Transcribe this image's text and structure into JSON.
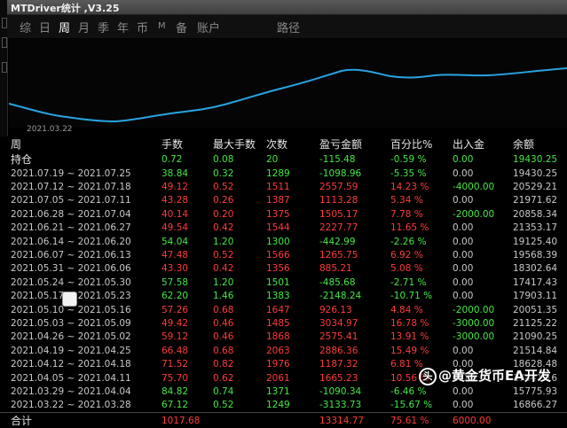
{
  "app": {
    "title": "MTDriver统计 ,V3.25"
  },
  "tabs": [
    {
      "label": "综"
    },
    {
      "label": "日"
    },
    {
      "label": "周",
      "active": true
    },
    {
      "label": "月"
    },
    {
      "label": "季"
    },
    {
      "label": "年"
    },
    {
      "label": "币"
    },
    {
      "label": "M"
    },
    {
      "label": "备"
    },
    {
      "label": "账户"
    },
    {
      "label": "路径"
    }
  ],
  "chart": {
    "date_label": "2021.03.22",
    "line_color": "#29a3e0"
  },
  "table": {
    "headers": [
      "周",
      "手数",
      "最大手数",
      "次数",
      "盈亏金额",
      "百分比%",
      "出入金",
      "余额"
    ],
    "position_row": {
      "label": "持仓",
      "lots": "0.72",
      "max": "0.08",
      "count": "20",
      "pnl": "-115.48",
      "pct": "-0.59 %",
      "io": "0.00",
      "bal": "19430.25"
    },
    "rows": [
      {
        "week": "2021.07.19 ~ 2021.07.25",
        "lots": "38.84",
        "max": "0.32",
        "count": "1289",
        "pnl": "-1098.96",
        "pct": "-5.35 %",
        "io": "0.00",
        "bal": "19430.25",
        "color": "#45e645"
      },
      {
        "week": "2021.07.12 ~ 2021.07.18",
        "lots": "49.12",
        "max": "0.52",
        "count": "1511",
        "pnl": "2557.59",
        "pct": "14.23 %",
        "io": "-4000.00",
        "bal": "20529.21",
        "color": "#ff3b3b"
      },
      {
        "week": "2021.07.05 ~ 2021.07.11",
        "lots": "43.28",
        "max": "0.26",
        "count": "1387",
        "pnl": "1113.28",
        "pct": "5.34 %",
        "io": "0.00",
        "bal": "21971.62",
        "color": "#ff3b3b"
      },
      {
        "week": "2021.06.28 ~ 2021.07.04",
        "lots": "40.14",
        "max": "0.20",
        "count": "1375",
        "pnl": "1505.17",
        "pct": "7.78 %",
        "io": "-2000.00",
        "bal": "20858.34",
        "color": "#ff3b3b"
      },
      {
        "week": "2021.06.21 ~ 2021.06.27",
        "lots": "49.54",
        "max": "0.42",
        "count": "1544",
        "pnl": "2227.77",
        "pct": "11.65 %",
        "io": "0.00",
        "bal": "21353.17",
        "color": "#ff3b3b"
      },
      {
        "week": "2021.06.14 ~ 2021.06.20",
        "lots": "54.04",
        "max": "1.20",
        "count": "1300",
        "pnl": "-442.99",
        "pct": "-2.26 %",
        "io": "0.00",
        "bal": "19125.40",
        "color": "#45e645"
      },
      {
        "week": "2021.06.07 ~ 2021.06.13",
        "lots": "47.48",
        "max": "0.52",
        "count": "1566",
        "pnl": "1265.75",
        "pct": "6.92 %",
        "io": "0.00",
        "bal": "19568.39",
        "color": "#ff3b3b"
      },
      {
        "week": "2021.05.31 ~ 2021.06.06",
        "lots": "43.30",
        "max": "0.42",
        "count": "1356",
        "pnl": "885.21",
        "pct": "5.08 %",
        "io": "0.00",
        "bal": "18302.64",
        "color": "#ff3b3b"
      },
      {
        "week": "2021.05.24 ~ 2021.05.30",
        "lots": "57.58",
        "max": "1.20",
        "count": "1501",
        "pnl": "-485.68",
        "pct": "-2.71 %",
        "io": "0.00",
        "bal": "17417.43",
        "color": "#45e645"
      },
      {
        "week": "2021.05.17 ~ 2021.05.23",
        "lots": "62.20",
        "max": "1.46",
        "count": "1383",
        "pnl": "-2148.24",
        "pct": "-10.71 %",
        "io": "0.00",
        "bal": "17903.11",
        "color": "#45e645"
      },
      {
        "week": "2021.05.10 ~ 2021.05.16",
        "lots": "57.26",
        "max": "0.68",
        "count": "1647",
        "pnl": "926.13",
        "pct": "4.84 %",
        "io": "-2000.00",
        "bal": "20051.35",
        "color": "#ff3b3b"
      },
      {
        "week": "2021.05.03 ~ 2021.05.09",
        "lots": "49.42",
        "max": "0.46",
        "count": "1485",
        "pnl": "3034.97",
        "pct": "16.78 %",
        "io": "-3000.00",
        "bal": "21125.22",
        "color": "#ff3b3b"
      },
      {
        "week": "2021.04.26 ~ 2021.05.02",
        "lots": "59.12",
        "max": "0.46",
        "count": "1868",
        "pnl": "2575.41",
        "pct": "13.91 %",
        "io": "-3000.00",
        "bal": "21090.25",
        "color": "#ff3b3b"
      },
      {
        "week": "2021.04.19 ~ 2021.04.25",
        "lots": "66.48",
        "max": "0.68",
        "count": "2063",
        "pnl": "2886.36",
        "pct": "15.49 %",
        "io": "0.00",
        "bal": "21514.84",
        "color": "#ff3b3b"
      },
      {
        "week": "2021.04.12 ~ 2021.04.18",
        "lots": "71.52",
        "max": "0.82",
        "count": "1976",
        "pnl": "1187.32",
        "pct": "6.81 %",
        "io": "0.00",
        "bal": "18628.48",
        "color": "#ff3b3b"
      },
      {
        "week": "2021.04.05 ~ 2021.04.11",
        "lots": "75.70",
        "max": "0.62",
        "count": "2061",
        "pnl": "1665.23",
        "pct": "10.56 %",
        "io": "0.00",
        "bal": "17441.16",
        "color": "#ff3b3b"
      },
      {
        "week": "2021.03.29 ~ 2021.04.04",
        "lots": "84.82",
        "max": "0.74",
        "count": "1371",
        "pnl": "-1090.34",
        "pct": "-6.46 %",
        "io": "0.00",
        "bal": "15775.93",
        "color": "#45e645"
      },
      {
        "week": "2021.03.22 ~ 2021.03.28",
        "lots": "67.12",
        "max": "0.52",
        "count": "1249",
        "pnl": "-3133.73",
        "pct": "-15.67 %",
        "io": "0.00",
        "bal": "16866.27",
        "color": "#45e645"
      }
    ],
    "total": {
      "label": "合计",
      "lots": "1017.68",
      "pnl": "13314.77",
      "pct": "75.61 %",
      "io": "6000.00"
    }
  },
  "watermark": {
    "logo": "头",
    "text": "@黄金货币EA开发"
  },
  "colors": {
    "positive": "#ff3b3b",
    "negative": "#45e645",
    "neutral": "#c8c8c8"
  }
}
